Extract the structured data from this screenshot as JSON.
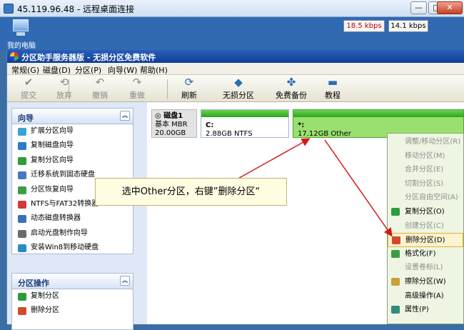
{
  "rdp": {
    "title": "45.119.96.48 - 远程桌面连接",
    "min_glyph": "—",
    "max_glyph": "□",
    "close_glyph": "✕"
  },
  "desktop": {
    "pc_label": "我的电脑",
    "upload_speed": "18.5 kbps",
    "download_speed": "14.1 kbps",
    "upload_color": "#cc0000",
    "download_color": "#000000"
  },
  "app": {
    "title": "分区助手服务器版 - 无损分区免费软件",
    "menu": [
      "常规(G)",
      "磁盘(D)",
      "分区(P)",
      "向导(W)",
      "帮助(H)"
    ],
    "toolbar": [
      {
        "label": "提交",
        "icon": "check-icon",
        "glyph": "✔",
        "disabled": true
      },
      {
        "label": "放弃",
        "icon": "discard-icon",
        "glyph": "⟲",
        "disabled": true
      },
      {
        "label": "撤销",
        "icon": "undo-icon",
        "glyph": "↶",
        "disabled": true
      },
      {
        "label": "重做",
        "icon": "redo-icon",
        "glyph": "↷",
        "disabled": true
      },
      {
        "label": "刷新",
        "icon": "refresh-icon",
        "glyph": "⟳",
        "disabled": false
      },
      {
        "label": "无损分区",
        "icon": "partition-icon",
        "glyph": "◆",
        "disabled": false
      },
      {
        "label": "免费备份",
        "icon": "backup-icon",
        "glyph": "✤",
        "disabled": false
      },
      {
        "label": "教程",
        "icon": "tutorial-icon",
        "glyph": "▬",
        "disabled": false
      }
    ]
  },
  "wizard_group": {
    "title": "向导",
    "collapse_glyph": "︽",
    "items": [
      {
        "label": "扩展分区向导",
        "color": "#3aa3d6"
      },
      {
        "label": "复制磁盘向导",
        "color": "#2b7bc4"
      },
      {
        "label": "复制分区向导",
        "color": "#2f9c3a"
      },
      {
        "label": "迁移系统到固态硬盘",
        "color": "#4a77c2"
      },
      {
        "label": "分区恢复向导",
        "color": "#3c9c44"
      },
      {
        "label": "NTFS与FAT32转换器",
        "color": "#d23a3a"
      },
      {
        "label": "动态磁盘转换器",
        "color": "#3c6fb8"
      },
      {
        "label": "启动光盘制作向导",
        "color": "#6b6b6b"
      },
      {
        "label": "安装Win8到移动硬盘",
        "color": "#2b8bc4"
      }
    ]
  },
  "ops_group": {
    "title": "分区操作",
    "collapse_glyph": "︽",
    "items": [
      {
        "label": "复制分区",
        "color": "#2f9c3a"
      },
      {
        "label": "删除分区",
        "color": "#d24a2a"
      }
    ]
  },
  "disk": {
    "name": "磁盘1",
    "type": "基本 MBR",
    "size": "20.00GB",
    "partitions": [
      {
        "name": "C:",
        "info": "2.88GB NTFS",
        "fill": 1.0
      },
      {
        "name": "*:",
        "info": "17.12GB Other",
        "fill": 1.0
      }
    ]
  },
  "context_menu": {
    "items": [
      {
        "label": "调整/移动分区(R)",
        "disabled": true,
        "icon": ""
      },
      {
        "label": "移动分区(M)",
        "disabled": true,
        "icon": ""
      },
      {
        "label": "合并分区(E)",
        "disabled": true,
        "icon": ""
      },
      {
        "label": "切割分区(S)",
        "disabled": true,
        "icon": ""
      },
      {
        "label": "分区自由空间(A)",
        "disabled": true,
        "icon": ""
      },
      {
        "label": "复制分区(O)",
        "disabled": false,
        "icon": "copy-partition-icon",
        "color": "#2f9c3a"
      },
      {
        "label": "创建分区(C)",
        "disabled": true,
        "icon": ""
      },
      {
        "label": "删除分区(D)",
        "disabled": false,
        "icon": "delete-partition-icon",
        "color": "#d24a2a",
        "active": true
      },
      {
        "label": "格式化(F)",
        "disabled": false,
        "icon": "format-icon",
        "color": "#3c9c44"
      },
      {
        "label": "设置卷标(L)",
        "disabled": true,
        "icon": ""
      },
      {
        "label": "擦除分区(W)",
        "disabled": false,
        "icon": "wipe-partition-icon",
        "color": "#c9a13a"
      },
      {
        "label": "高级操作(A)",
        "disabled": false,
        "icon": ""
      },
      {
        "label": "属性(P)",
        "disabled": false,
        "icon": "properties-icon",
        "color": "#2f8c7a"
      }
    ]
  },
  "annotation": {
    "text": "选中Other分区，右键”删除分区“",
    "arrow_color": "#d11a1a"
  }
}
